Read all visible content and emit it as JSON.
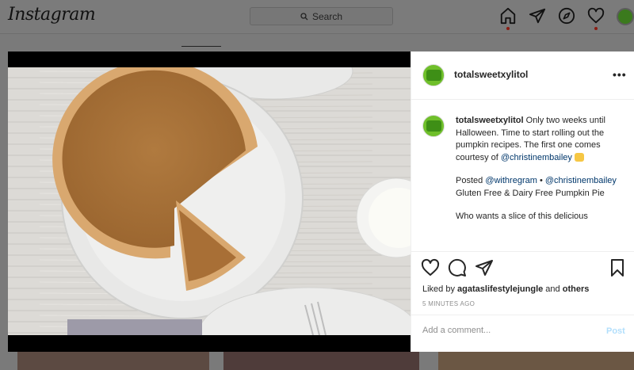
{
  "topbar": {
    "logo": "Instagram",
    "search_placeholder": "Search",
    "icons": [
      "home-icon",
      "direct-icon",
      "explore-icon",
      "heart-icon",
      "avatar"
    ]
  },
  "post": {
    "username": "totalsweetxylitol",
    "more_label": "•••",
    "caption": {
      "username": "totalsweetxylitol",
      "text1": " Only two weeks until Halloween. Time to start rolling out the pumpkin recipes. The first one comes courtesy of ",
      "mention1": "@christinembailey",
      "text2": "Posted ",
      "mention2": "@withregram",
      "text3": " • ",
      "mention3": "@christinembailey",
      "text4": " Gluten Free & Dairy Free Pumpkin Pie",
      "text5": "Who wants a slice of this delicious"
    },
    "likes": {
      "prefix": "Liked by ",
      "user": "agataslifestylejungle",
      "and": " and ",
      "others": "others"
    },
    "timestamp": "5 MINUTES AGO",
    "comment_placeholder": "Add a comment...",
    "post_label": "Post"
  },
  "colors": {
    "link": "#00376b",
    "post_button": "#b2dffc",
    "overlay": "#7a7a7a"
  }
}
